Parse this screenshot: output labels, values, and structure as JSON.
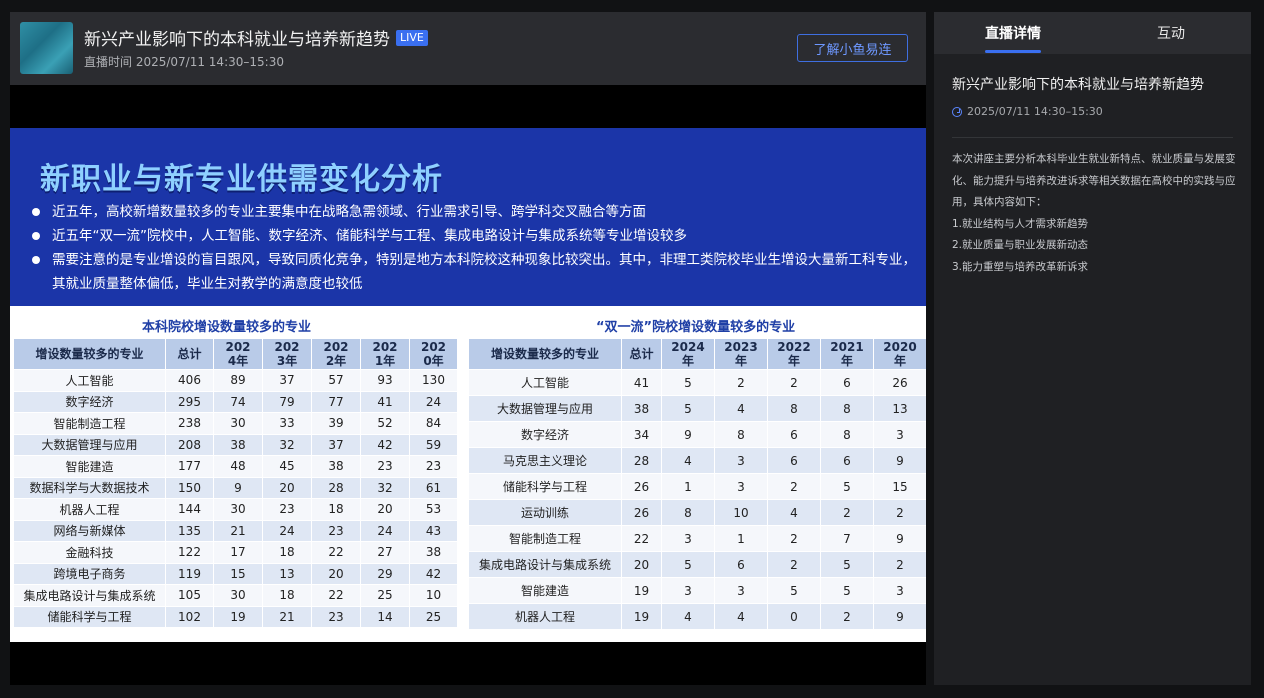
{
  "header": {
    "title": "新兴产业影响下的本科就业与培养新趋势",
    "badge": "LIVE",
    "subtitle": "直播时间 2025/07/11 14:30–15:30",
    "follow_button": "了解小鱼易连"
  },
  "slide": {
    "title": "新职业与新专业供需变化分析",
    "bullets": [
      "近五年，高校新增数量较多的专业主要集中在战略急需领域、行业需求引导、跨学科交叉融合等方面",
      "近五年“双一流”院校中，人工智能、数字经济、储能科学与工程、集成电路设计与集成系统等专业增设较多",
      "需要注意的是专业增设的盲目跟风，导致同质化竞争，特别是地方本科院校这种现象比较突出。其中，非理工类院校毕业生增设大量新工科专业，其就业质量整体偏低，毕业生对教学的满意度也较低"
    ],
    "table1": {
      "title": "本科院校增设数量较多的专业",
      "headers": [
        "增设数量较多的专业",
        "总计",
        "2024年",
        "2023年",
        "2022年",
        "2021年",
        "2020年"
      ],
      "rows": [
        [
          "人工智能",
          "406",
          "89",
          "37",
          "57",
          "93",
          "130"
        ],
        [
          "数字经济",
          "295",
          "74",
          "79",
          "77",
          "41",
          "24"
        ],
        [
          "智能制造工程",
          "238",
          "30",
          "33",
          "39",
          "52",
          "84"
        ],
        [
          "大数据管理与应用",
          "208",
          "38",
          "32",
          "37",
          "42",
          "59"
        ],
        [
          "智能建造",
          "177",
          "48",
          "45",
          "38",
          "23",
          "23"
        ],
        [
          "数据科学与大数据技术",
          "150",
          "9",
          "20",
          "28",
          "32",
          "61"
        ],
        [
          "机器人工程",
          "144",
          "30",
          "23",
          "18",
          "20",
          "53"
        ],
        [
          "网络与新媒体",
          "135",
          "21",
          "24",
          "23",
          "24",
          "43"
        ],
        [
          "金融科技",
          "122",
          "17",
          "18",
          "22",
          "27",
          "38"
        ],
        [
          "跨境电子商务",
          "119",
          "15",
          "13",
          "20",
          "29",
          "42"
        ],
        [
          "集成电路设计与集成系统",
          "105",
          "30",
          "18",
          "22",
          "25",
          "10"
        ],
        [
          "储能科学与工程",
          "102",
          "19",
          "21",
          "23",
          "14",
          "25"
        ]
      ]
    },
    "table2": {
      "title": "“双一流”院校增设数量较多的专业",
      "headers": [
        "增设数量较多的专业",
        "总计",
        "2024年",
        "2023年",
        "2022年",
        "2021年",
        "2020年"
      ],
      "rows": [
        [
          "人工智能",
          "41",
          "5",
          "2",
          "2",
          "6",
          "26"
        ],
        [
          "大数据管理与应用",
          "38",
          "5",
          "4",
          "8",
          "8",
          "13"
        ],
        [
          "数字经济",
          "34",
          "9",
          "8",
          "6",
          "8",
          "3"
        ],
        [
          "马克思主义理论",
          "28",
          "4",
          "3",
          "6",
          "6",
          "9"
        ],
        [
          "储能科学与工程",
          "26",
          "1",
          "3",
          "2",
          "5",
          "15"
        ],
        [
          "运动训练",
          "26",
          "8",
          "10",
          "4",
          "2",
          "2"
        ],
        [
          "智能制造工程",
          "22",
          "3",
          "1",
          "2",
          "7",
          "9"
        ],
        [
          "集成电路设计与集成系统",
          "20",
          "5",
          "6",
          "2",
          "5",
          "2"
        ],
        [
          "智能建造",
          "19",
          "3",
          "3",
          "5",
          "5",
          "3"
        ],
        [
          "机器人工程",
          "19",
          "4",
          "4",
          "0",
          "2",
          "9"
        ]
      ]
    }
  },
  "sidebar": {
    "tabs": [
      {
        "label": "直播详情",
        "active": true
      },
      {
        "label": "互动",
        "active": false
      }
    ],
    "title": "新兴产业影响下的本科就业与培养新趋势",
    "time": "2025/07/11 14:30–15:30",
    "description": "本次讲座主要分析本科毕业生就业新特点、就业质量与发展变化、能力提升与培养改进诉求等相关数据在高校中的实践与应用，具体内容如下：",
    "items": [
      "1.就业结构与人才需求新趋势",
      "2.就业质量与职业发展新动态",
      "3.能力重塑与培养改革新诉求"
    ]
  },
  "colors": {
    "accent": "#3a6ff0",
    "slide_header_bg": "#1b35a8",
    "table_header_bg": "#b9cbe8"
  }
}
